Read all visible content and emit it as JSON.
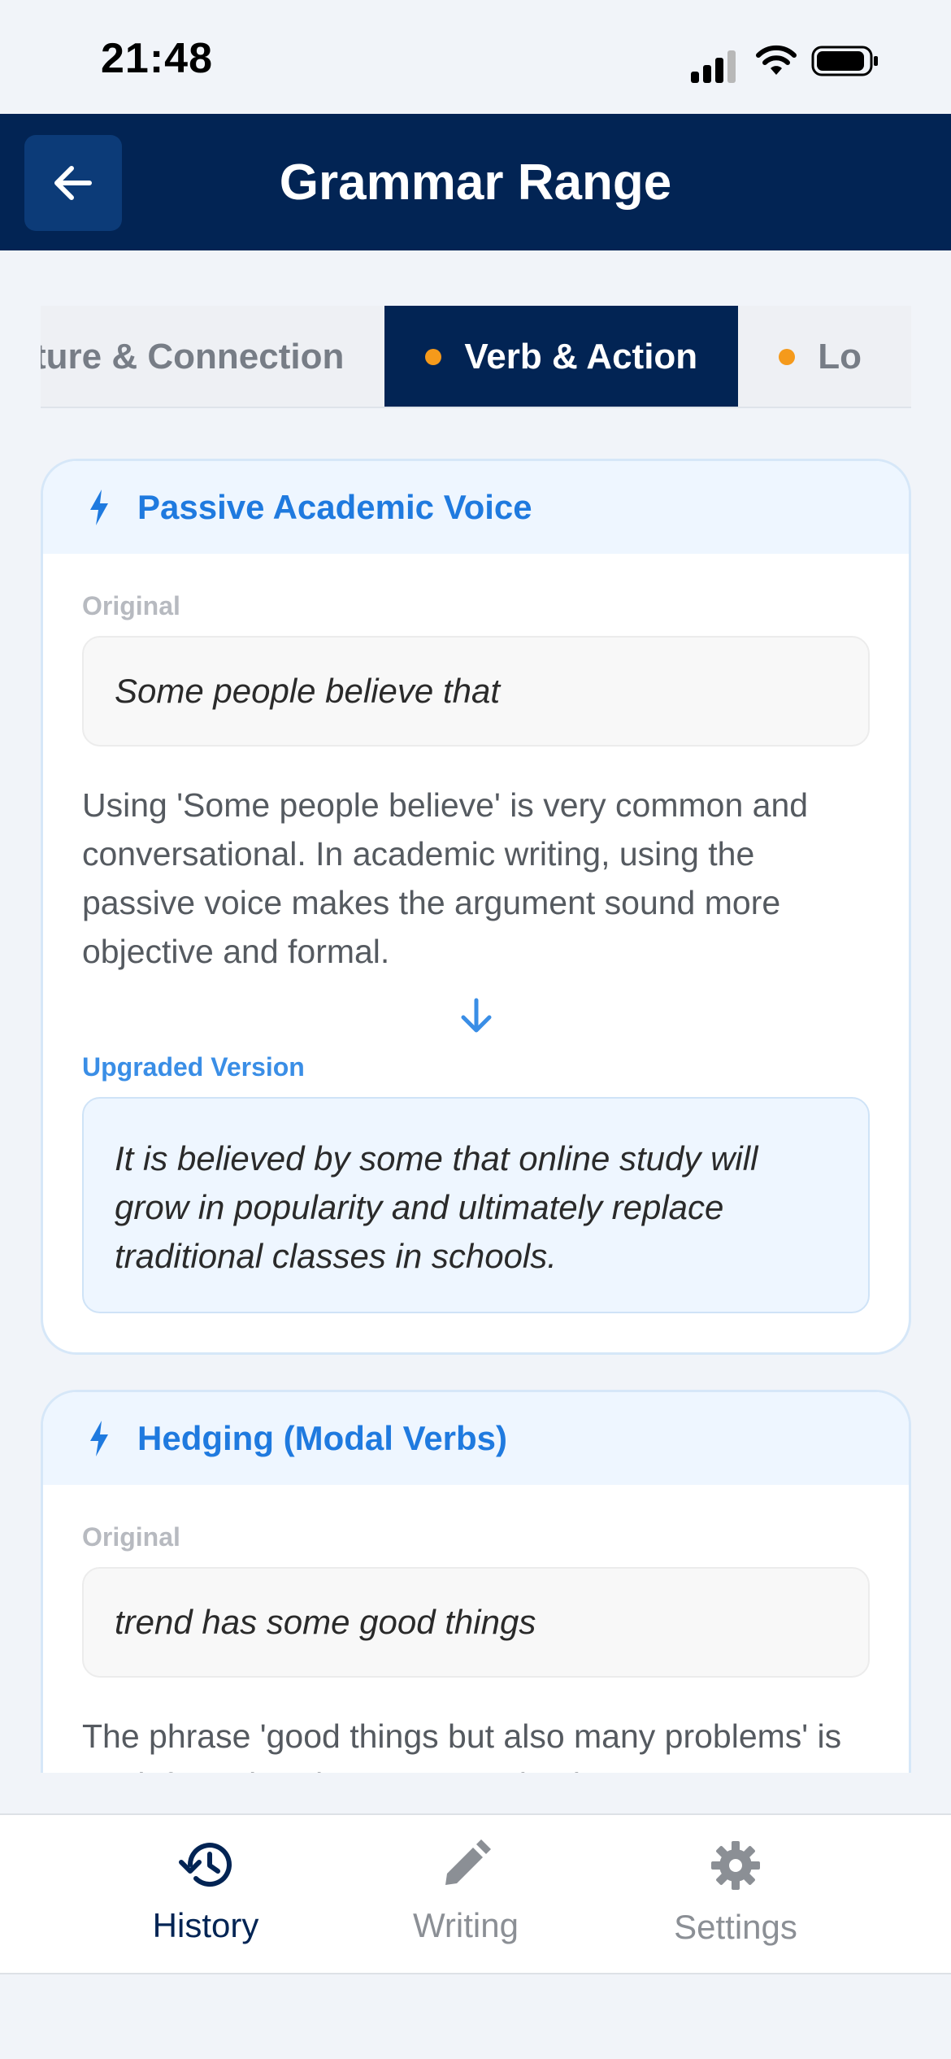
{
  "status_bar": {
    "time": "21:48"
  },
  "header": {
    "title": "Grammar Range"
  },
  "tabs": [
    {
      "label": "Structure & Connection",
      "visible_label": "ture & Connection",
      "dot": false,
      "active": false
    },
    {
      "label": "Verb & Action",
      "dot": true,
      "active": true
    },
    {
      "label": "Lo",
      "dot": true,
      "active": false
    }
  ],
  "cards": [
    {
      "icon": "bolt-icon",
      "title": "Passive Academic Voice",
      "original_label": "Original",
      "original": "Some people believe that",
      "explanation": "Using 'Some people believe' is very common and conversational. In academic writing, using the passive voice makes the argument sound more objective and formal.",
      "upgraded_label": "Upgraded Version",
      "upgraded": "It is believed by some that online study will grow in popularity and ultimately replace traditional classes in schools."
    },
    {
      "icon": "bolt-icon",
      "title": "Hedging (Modal Verbs)",
      "original_label": "Original",
      "original": "trend has some good things",
      "explanation": "The phrase 'good things but also many problems' is too informal. Using more academic"
    }
  ],
  "bottom_nav": [
    {
      "label": "History",
      "icon": "history-icon",
      "active": true
    },
    {
      "label": "Writing",
      "icon": "pencil-icon",
      "active": false
    },
    {
      "label": "Settings",
      "icon": "gear-icon",
      "active": false
    }
  ],
  "colors": {
    "header_bg": "#022454",
    "accent_blue": "#1f7adf",
    "tab_dot": "#f59a1b",
    "page_bg": "#f1f4f9"
  }
}
